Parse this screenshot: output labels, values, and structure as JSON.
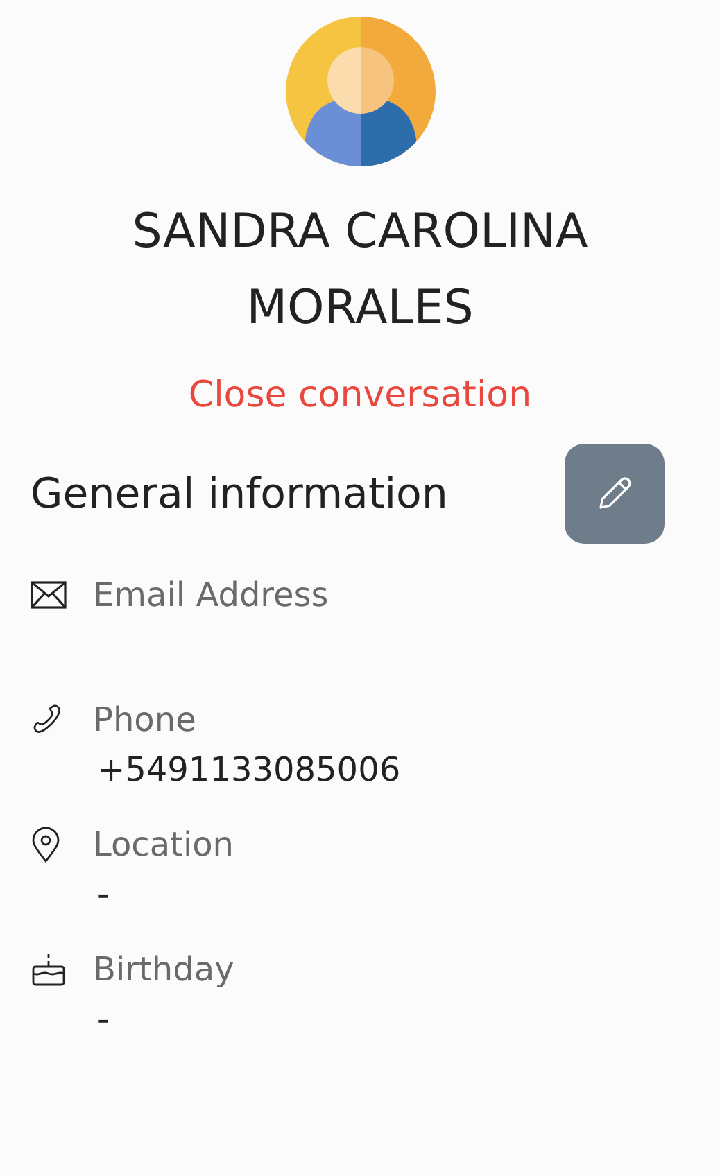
{
  "contact": {
    "name": "SANDRA CAROLINA MORALES",
    "close_link": "Close conversation"
  },
  "section": {
    "title": "General information"
  },
  "fields": [
    {
      "kind": "email",
      "label": "Email Address"
    },
    {
      "kind": "phone",
      "label": "Phone",
      "value": "+5491133085006"
    },
    {
      "kind": "location",
      "label": "Location",
      "value": "-"
    },
    {
      "kind": "birthday",
      "label": "Birthday",
      "value": "-"
    }
  ]
}
